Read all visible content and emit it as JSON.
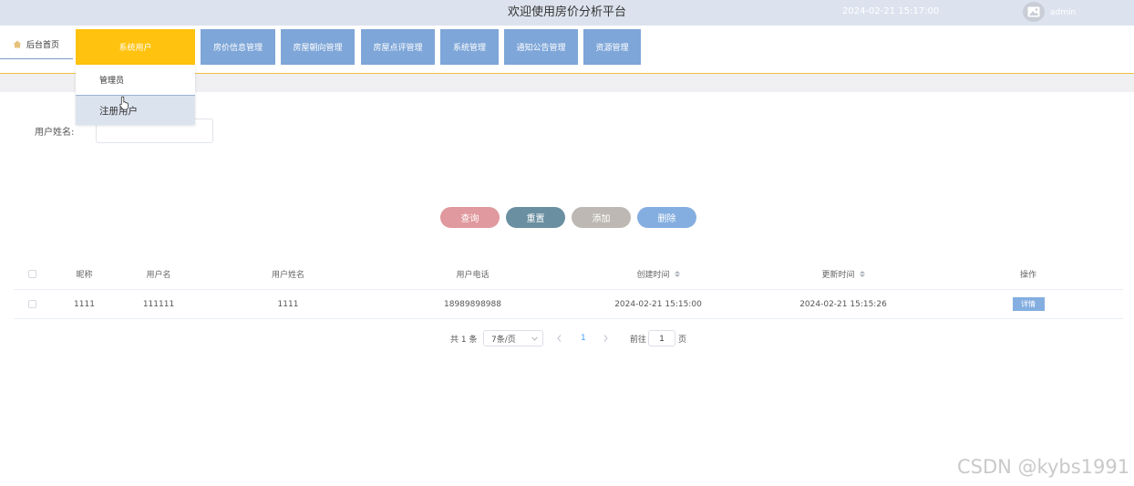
{
  "header": {
    "title": "欢迎使用房价分析平台",
    "datetime": "2024-02-21 15:17:00",
    "username": "admin",
    "avatar_icon": "image-placeholder-icon"
  },
  "nav": {
    "home_label": "后台首页",
    "home_icon": "home-icon",
    "items": [
      {
        "label": "系统用户",
        "active": true
      },
      {
        "label": "房价信息管理"
      },
      {
        "label": "房屋朝向管理"
      },
      {
        "label": "房屋点评管理"
      },
      {
        "label": "系统管理"
      },
      {
        "label": "通知公告管理"
      },
      {
        "label": "资源管理"
      }
    ],
    "dropdown": [
      "管理员",
      "注册用户"
    ]
  },
  "search": {
    "label": "用户姓名:",
    "value": "",
    "placeholder": ""
  },
  "actions": {
    "query": "查询",
    "reset": "重置",
    "add": "添加",
    "delete": "删除"
  },
  "table": {
    "headers": [
      "昵称",
      "用户名",
      "用户姓名",
      "用户电话",
      "创建时间",
      "更新时间",
      "操作"
    ],
    "rows": [
      {
        "nickname": "1111",
        "username": "111111",
        "realname": "1111",
        "phone": "18989898988",
        "created": "2024-02-21 15:15:00",
        "updated": "2024-02-21 15:15:26",
        "action": "详情"
      }
    ]
  },
  "pagination": {
    "total": "共 1 条",
    "page_size": "7条/页",
    "current_page": "1",
    "goto_label": "前往",
    "goto_value": "1",
    "page_suffix": "页"
  },
  "watermark": "CSDN @kybs1991",
  "colors": {
    "header_bg": "#dce3ee",
    "nav_active": "#ffc20e",
    "nav_item": "#7ea6d8",
    "query_btn": "#e0999e",
    "reset_btn": "#6a8fa0",
    "add_btn": "#bdb8b3",
    "delete_btn": "#84aee0"
  }
}
